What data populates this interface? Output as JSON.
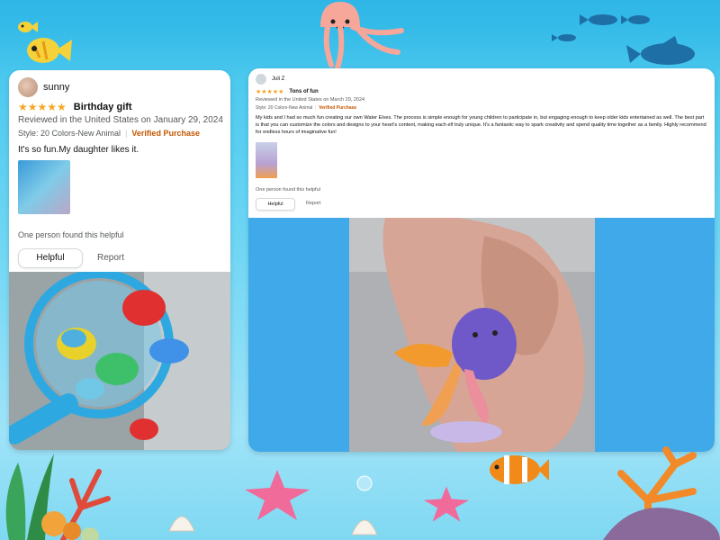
{
  "reviews": [
    {
      "reviewer": "sunny",
      "stars": "★★★★★",
      "title": "Birthday gift",
      "reviewed": "Reviewed in the United States on January 29, 2024",
      "style": "Style: 20 Colors-New Animal",
      "verified": "Verified Purchase",
      "body": "It's so fun.My daughter likes it.",
      "found_helpful": "One person found this helpful",
      "helpful_label": "Helpful",
      "report_label": "Report",
      "rating": 5
    },
    {
      "reviewer": "Juli Z",
      "stars": "★★★★★",
      "title": "Tons of fun",
      "reviewed": "Reviewed in the United States on March 29, 2024",
      "style": "Style: 20 Colors-New Animal",
      "verified": "Verified Purchase",
      "body": "My kids and I had so much fun creating our own Water Elves. The process is simple enough for young children to participate in, but engaging enough to keep older kids entertained as well. The best part is that you can customize the colors and designs to your heart's content, making each elf truly unique. It's a fantastic way to spark creativity and spend quality time together as a family. Highly recommend for endless hours of imaginative fun!",
      "found_helpful": "One person found this helpful",
      "helpful_label": "Helpful",
      "report_label": "Report",
      "rating": 5
    }
  ],
  "colors": {
    "star": "#f5a623",
    "verified": "#c45500",
    "ocean": "#3cc3ec",
    "photo_band": "#3fa9ea"
  },
  "decor": [
    "jellyfish",
    "yellow-fish",
    "blue-fish-school",
    "coral",
    "starfish",
    "clownfish",
    "seashell",
    "bubbles"
  ]
}
